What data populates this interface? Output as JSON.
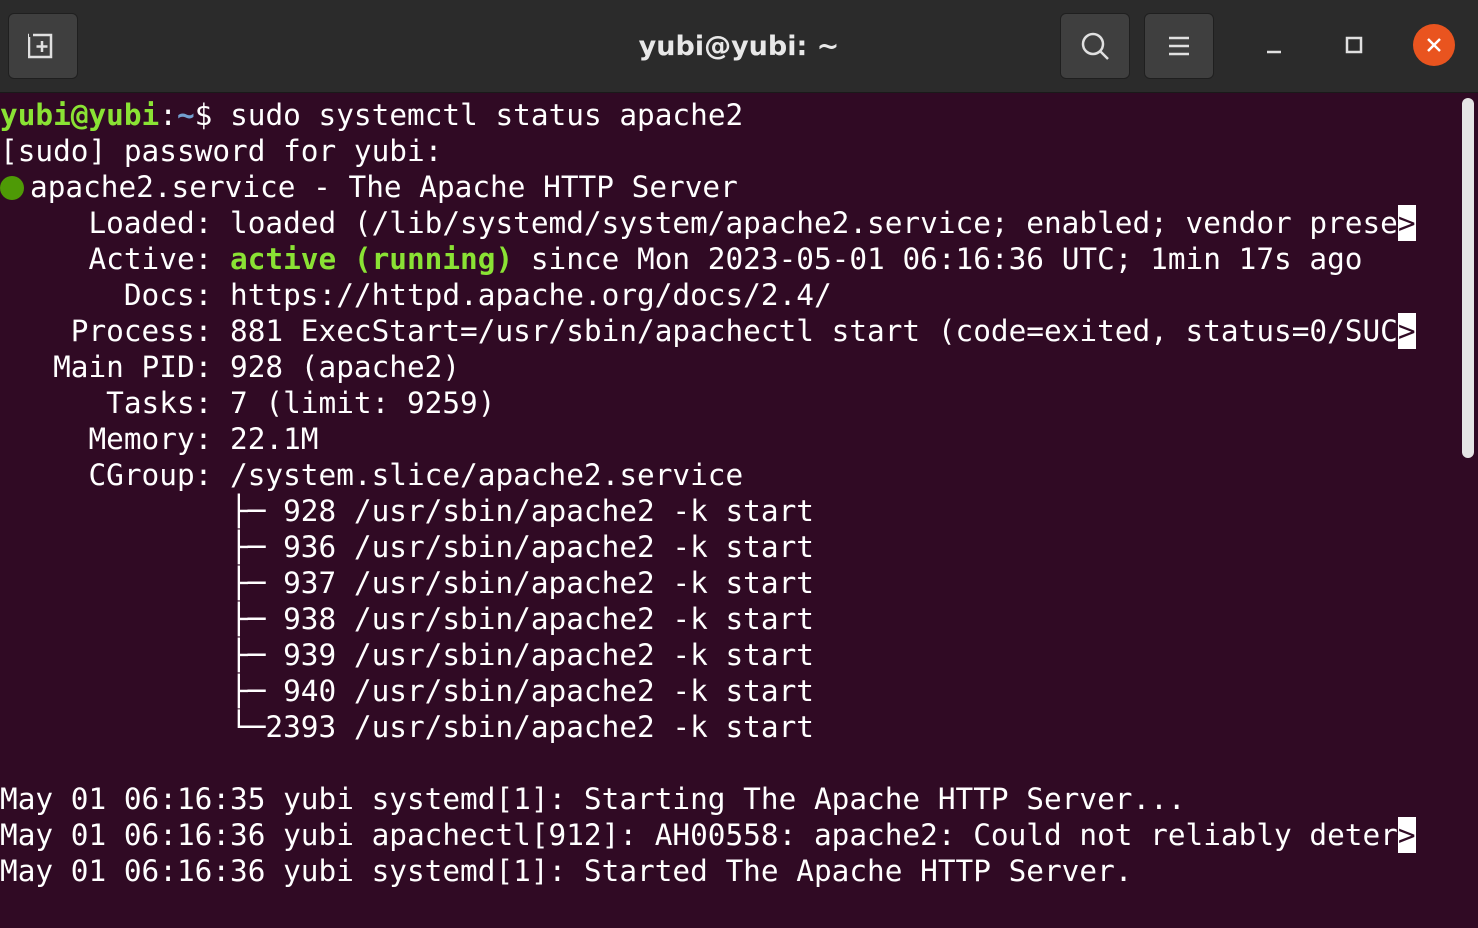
{
  "window": {
    "title": "yubi@yubi: ~"
  },
  "terminal": {
    "prompt_user": "yubi@yubi",
    "prompt_sep": ":",
    "prompt_path": "~",
    "prompt_symbol": "$ ",
    "command": "sudo systemctl status apache2",
    "sudo_prompt": "[sudo] password for yubi:",
    "service_header": "apache2.service - The Apache HTTP Server",
    "loaded_label": "     Loaded: ",
    "loaded_value": "loaded (/lib/systemd/system/apache2.service; enabled; vendor prese",
    "active_label": "     Active: ",
    "active_state": "active (running)",
    "active_rest": " since Mon 2023-05-01 06:16:36 UTC; 1min 17s ago",
    "docs_line": "       Docs: https://httpd.apache.org/docs/2.4/",
    "process_line": "    Process: 881 ExecStart=/usr/sbin/apachectl start (code=exited, status=0/SUC",
    "mainpid_line": "   Main PID: 928 (apache2)",
    "tasks_line": "      Tasks: 7 (limit: 9259)",
    "memory_line": "     Memory: 22.1M",
    "cgroup_line": "     CGroup: /system.slice/apache2.service",
    "cgroup_children": [
      "             ├─ 928 /usr/sbin/apache2 -k start",
      "             ├─ 936 /usr/sbin/apache2 -k start",
      "             ├─ 937 /usr/sbin/apache2 -k start",
      "             ├─ 938 /usr/sbin/apache2 -k start",
      "             ├─ 939 /usr/sbin/apache2 -k start",
      "             ├─ 940 /usr/sbin/apache2 -k start",
      "             └─2393 /usr/sbin/apache2 -k start"
    ],
    "log_lines": [
      "May 01 06:16:35 yubi systemd[1]: Starting The Apache HTTP Server...",
      "May 01 06:16:36 yubi apachectl[912]: AH00558: apache2: Could not reliably deter",
      "May 01 06:16:36 yubi systemd[1]: Started The Apache HTTP Server."
    ],
    "overflow_marker": ">"
  },
  "colors": {
    "background": "#300a24",
    "titlebar": "#2b2b2b",
    "prompt_green": "#8ae234",
    "prompt_blue": "#729fcf",
    "status_dot": "#4e9a06",
    "close_button": "#e9541f"
  },
  "icons": {
    "new_tab": "new-tab-icon",
    "search": "search-icon",
    "menu": "hamburger-menu-icon",
    "minimize": "minimize-icon",
    "maximize": "maximize-icon",
    "close": "close-icon"
  }
}
